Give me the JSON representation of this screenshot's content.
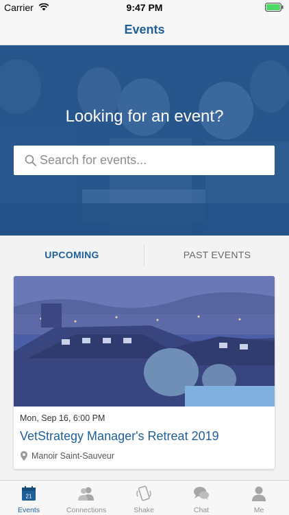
{
  "status_bar": {
    "carrier": "Carrier",
    "time": "9:47 PM",
    "wifi_icon": "wifi-icon",
    "battery_icon": "battery-icon",
    "battery_color": "#4cd964"
  },
  "nav": {
    "title": "Events"
  },
  "hero": {
    "title": "Looking for an event?",
    "search": {
      "placeholder": "Search for events...",
      "value": "",
      "icon": "search-icon"
    }
  },
  "tabs": [
    {
      "label": "UPCOMING",
      "selected": true
    },
    {
      "label": "PAST EVENTS",
      "selected": false
    }
  ],
  "events": [
    {
      "date": "Mon, Sep 16, 6:00 PM",
      "title": "VetStrategy Manager's Retreat 2019",
      "location": "Manoir Saint-Sauveur",
      "location_icon": "map-pin-icon"
    }
  ],
  "tab_bar": {
    "calendar_day": "21",
    "items": [
      {
        "label": "Events",
        "icon": "calendar-icon",
        "active": true
      },
      {
        "label": "Connections",
        "icon": "people-icon",
        "active": false
      },
      {
        "label": "Shake",
        "icon": "shake-phone-icon",
        "active": false
      },
      {
        "label": "Chat",
        "icon": "chat-bubbles-icon",
        "active": false
      },
      {
        "label": "Me",
        "icon": "person-icon",
        "active": false
      }
    ]
  },
  "colors": {
    "accent": "#1f5f99",
    "hero_overlay": "#1f5594",
    "inactive": "#8f8f8f"
  }
}
